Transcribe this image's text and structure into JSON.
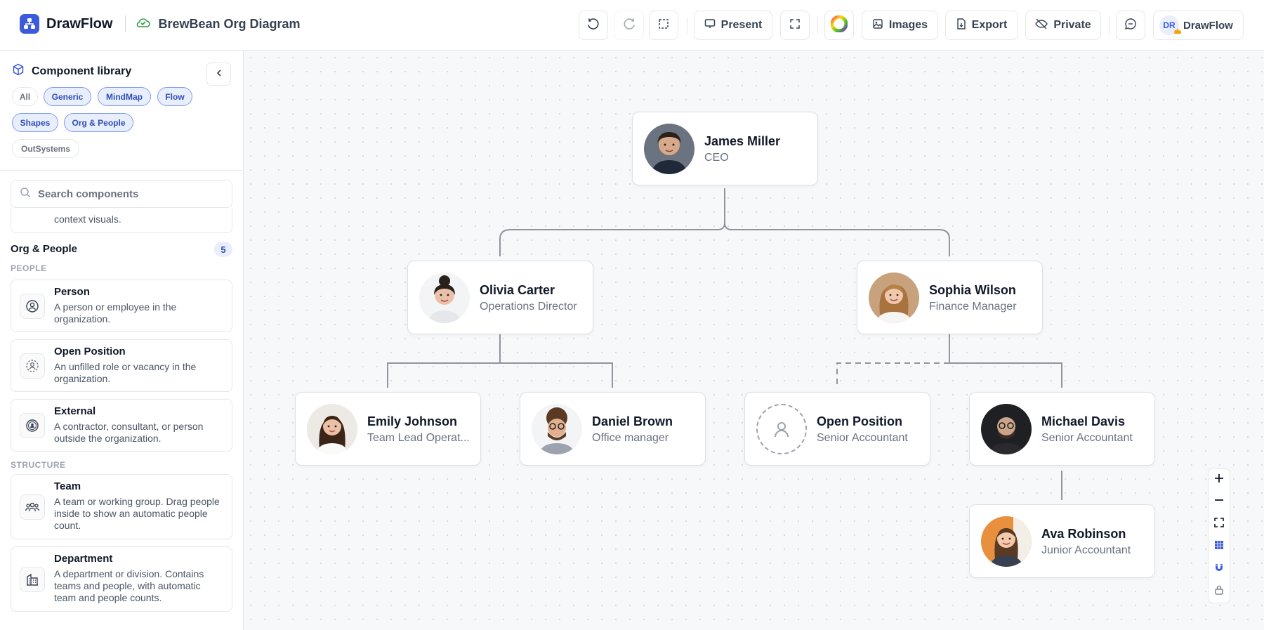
{
  "app": {
    "name": "DrawFlow",
    "doc_title": "BrewBean Org Diagram"
  },
  "toolbar": {
    "undo_icon": "undo-icon",
    "redo_icon": "redo-icon",
    "select_icon": "selection-icon",
    "present_label": "Present",
    "fit_icon": "fit-screen-icon",
    "theme_icon": "color-wheel-icon",
    "images_label": "Images",
    "export_label": "Export",
    "private_label": "Private",
    "comments_icon": "comment-icon",
    "user_initials": "DR",
    "user_label": "DrawFlow"
  },
  "sidebar": {
    "title": "Component library",
    "chips": [
      {
        "label": "All",
        "active": false
      },
      {
        "label": "Generic",
        "active": true
      },
      {
        "label": "MindMap",
        "active": true
      },
      {
        "label": "Flow",
        "active": true
      },
      {
        "label": "Shapes",
        "active": true
      },
      {
        "label": "Org & People",
        "active": true
      },
      {
        "label": "OutSystems",
        "active": false
      }
    ],
    "search_placeholder": "Search components",
    "prev_item_text": "context visuals.",
    "section_title": "Org & People",
    "section_count": "5",
    "people_label": "PEOPLE",
    "structure_label": "STRUCTURE",
    "components": [
      {
        "name": "Person",
        "desc": "A person or employee in the organization.",
        "icon": "person-icon"
      },
      {
        "name": "Open Position",
        "desc": "An unfilled role or vacancy in the organization.",
        "icon": "open-position-icon"
      },
      {
        "name": "External",
        "desc": "A contractor, consultant, or person outside the organization.",
        "icon": "external-person-icon"
      },
      {
        "name": "Team",
        "desc": "A team or working group. Drag people inside to show an automatic people count.",
        "icon": "team-icon"
      },
      {
        "name": "Department",
        "desc": "A department or division. Contains teams and people, with automatic team and people counts.",
        "icon": "building-icon"
      }
    ]
  },
  "org": {
    "nodes": [
      {
        "name": "James Miller",
        "role": "CEO"
      },
      {
        "name": "Olivia Carter",
        "role": "Operations Director"
      },
      {
        "name": "Sophia Wilson",
        "role": "Finance Manager"
      },
      {
        "name": "Emily Johnson",
        "role": "Team Lead Operat..."
      },
      {
        "name": "Daniel Brown",
        "role": "Office manager"
      },
      {
        "name": "Open Position",
        "role": "Senior Accountant"
      },
      {
        "name": "Michael Davis",
        "role": "Senior Accountant"
      },
      {
        "name": "Ava Robinson",
        "role": "Junior Accountant"
      }
    ]
  },
  "zoom_controls": [
    "zoom-in-icon",
    "zoom-out-icon",
    "fit-view-icon",
    "grid-icon",
    "snap-magnet-icon",
    "lock-icon"
  ],
  "colors": {
    "accent": "#3b5bdb",
    "chip_bg": "#e8eefc",
    "chip_border": "#7f9cf5"
  }
}
